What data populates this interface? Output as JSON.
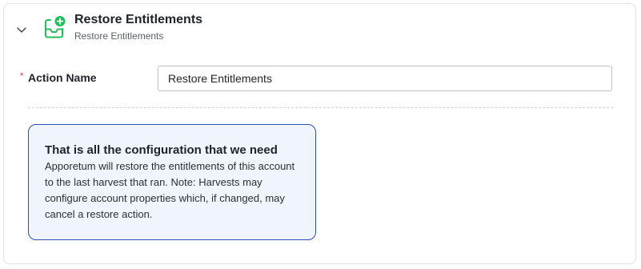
{
  "header": {
    "title": "Restore Entitlements",
    "subtitle": "Restore Entitlements",
    "chevron_icon": "chevron-down-icon",
    "action_icon": "tray-plus-icon",
    "accent_color": "#1fbf5a"
  },
  "form": {
    "required_marker": "*",
    "action_name_label": "Action Name",
    "action_name_value": "Restore Entitlements"
  },
  "info": {
    "title": "That is all the configuration that we need",
    "body": "Apporetum will restore the entitlements of this account to the last harvest that ran. Note: Harvests may configure account properties which, if changed, may cancel a restore action.",
    "border_color": "#2d4fb8",
    "background_color": "#f0f4fd"
  }
}
